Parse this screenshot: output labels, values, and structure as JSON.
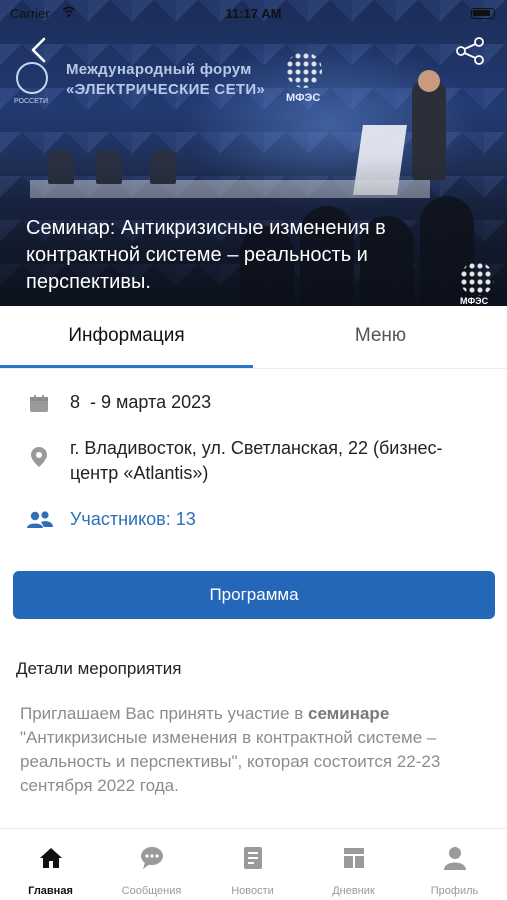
{
  "status_bar": {
    "carrier": "Carrier",
    "time": "11:17 AM"
  },
  "hero": {
    "banner_line1": "Международный форум",
    "banner_line2": "«ЭЛЕКТРИЧЕСКИЕ СЕТИ»",
    "logo_left_label": "РОССЕТИ",
    "logo_right_label": "МФЭС",
    "logo_corner_label": "МФЭС",
    "event_title": "Семинар: Антикризисные изменения в контрактной системе – реальность и перспективы."
  },
  "tabs": [
    {
      "label": "Информация",
      "active": true
    },
    {
      "label": "Меню",
      "active": false
    }
  ],
  "info": {
    "date": "8  - 9 марта 2023",
    "location": "г. Владивосток, ул. Светланская, 22 (бизнес-центр «Atlantis»)",
    "participants": "Участников: 13"
  },
  "program_button": "Программа",
  "details": {
    "title": "Детали мероприятия",
    "text_prefix": "Приглашаем Вас принять участие в ",
    "text_bold": "семинаре",
    "text_rest": " \"Антикризисные изменения в контрактной системе – реальность и перспективы\", которая состоится 22-23 сентября 2022 года."
  },
  "tabbar": [
    {
      "label": "Главная",
      "icon": "home-icon",
      "active": true
    },
    {
      "label": "Сообщения",
      "icon": "chat-icon",
      "active": false
    },
    {
      "label": "Новости",
      "icon": "news-icon",
      "active": false
    },
    {
      "label": "Дневник",
      "icon": "diary-icon",
      "active": false
    },
    {
      "label": "Профиль",
      "icon": "profile-icon",
      "active": false
    }
  ],
  "colors": {
    "accent": "#2467b8",
    "link": "#2d6fb8",
    "tab_underline": "#2d73c4",
    "icon_gray": "#9a9a9a"
  }
}
